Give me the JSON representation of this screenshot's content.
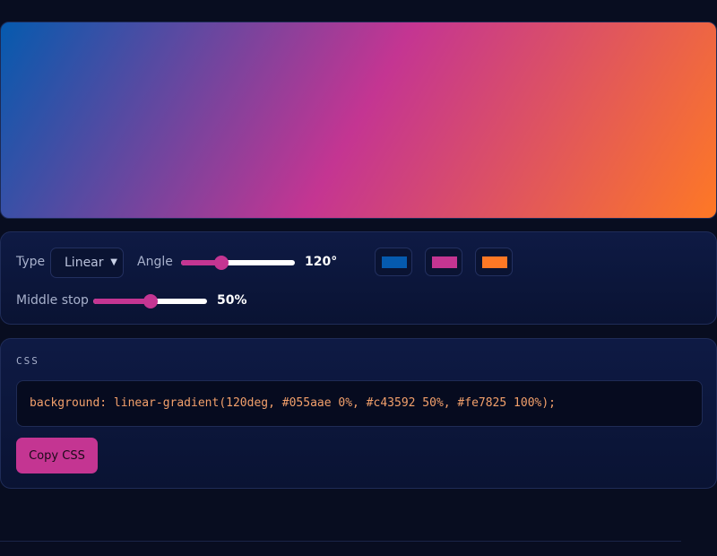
{
  "gradient": {
    "type": "Linear",
    "angle_deg": 120,
    "angle_text": "120°",
    "middle_stop_pct": 50,
    "middle_stop_text": "50%",
    "angle_range": [
      0,
      360
    ],
    "stop_range": [
      0,
      100
    ],
    "stops": [
      {
        "name": "start-color",
        "color": "#055aae",
        "pos": 0
      },
      {
        "name": "middle-color",
        "color": "#c43592",
        "pos": 50
      },
      {
        "name": "end-color",
        "color": "#fe7825",
        "pos": 100
      }
    ]
  },
  "controls": {
    "type_label": "Type",
    "type_value": "Linear",
    "angle_label": "Angle",
    "middle_stop_label": "Middle stop"
  },
  "css_panel": {
    "title": "CSS",
    "code": "background: linear-gradient(120deg, #055aae 0%, #c43592 50%, #fe7825 100%);",
    "copy_label": "Copy CSS"
  },
  "colors": {
    "accent": "#c43592",
    "background": "#080d20",
    "code_text": "#f2a06b"
  }
}
